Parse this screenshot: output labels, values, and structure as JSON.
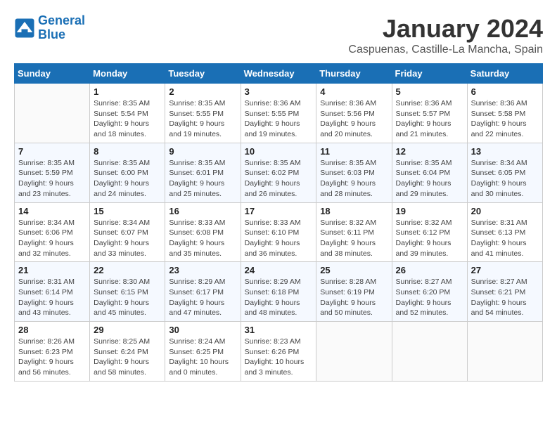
{
  "header": {
    "logo_line1": "General",
    "logo_line2": "Blue",
    "title": "January 2024",
    "subtitle": "Caspuenas, Castille-La Mancha, Spain"
  },
  "days_of_week": [
    "Sunday",
    "Monday",
    "Tuesday",
    "Wednesday",
    "Thursday",
    "Friday",
    "Saturday"
  ],
  "weeks": [
    [
      {
        "day": "",
        "sunrise": "",
        "sunset": "",
        "daylight": ""
      },
      {
        "day": "1",
        "sunrise": "Sunrise: 8:35 AM",
        "sunset": "Sunset: 5:54 PM",
        "daylight": "Daylight: 9 hours and 18 minutes."
      },
      {
        "day": "2",
        "sunrise": "Sunrise: 8:35 AM",
        "sunset": "Sunset: 5:55 PM",
        "daylight": "Daylight: 9 hours and 19 minutes."
      },
      {
        "day": "3",
        "sunrise": "Sunrise: 8:36 AM",
        "sunset": "Sunset: 5:55 PM",
        "daylight": "Daylight: 9 hours and 19 minutes."
      },
      {
        "day": "4",
        "sunrise": "Sunrise: 8:36 AM",
        "sunset": "Sunset: 5:56 PM",
        "daylight": "Daylight: 9 hours and 20 minutes."
      },
      {
        "day": "5",
        "sunrise": "Sunrise: 8:36 AM",
        "sunset": "Sunset: 5:57 PM",
        "daylight": "Daylight: 9 hours and 21 minutes."
      },
      {
        "day": "6",
        "sunrise": "Sunrise: 8:36 AM",
        "sunset": "Sunset: 5:58 PM",
        "daylight": "Daylight: 9 hours and 22 minutes."
      }
    ],
    [
      {
        "day": "7",
        "sunrise": "Sunrise: 8:35 AM",
        "sunset": "Sunset: 5:59 PM",
        "daylight": "Daylight: 9 hours and 23 minutes."
      },
      {
        "day": "8",
        "sunrise": "Sunrise: 8:35 AM",
        "sunset": "Sunset: 6:00 PM",
        "daylight": "Daylight: 9 hours and 24 minutes."
      },
      {
        "day": "9",
        "sunrise": "Sunrise: 8:35 AM",
        "sunset": "Sunset: 6:01 PM",
        "daylight": "Daylight: 9 hours and 25 minutes."
      },
      {
        "day": "10",
        "sunrise": "Sunrise: 8:35 AM",
        "sunset": "Sunset: 6:02 PM",
        "daylight": "Daylight: 9 hours and 26 minutes."
      },
      {
        "day": "11",
        "sunrise": "Sunrise: 8:35 AM",
        "sunset": "Sunset: 6:03 PM",
        "daylight": "Daylight: 9 hours and 28 minutes."
      },
      {
        "day": "12",
        "sunrise": "Sunrise: 8:35 AM",
        "sunset": "Sunset: 6:04 PM",
        "daylight": "Daylight: 9 hours and 29 minutes."
      },
      {
        "day": "13",
        "sunrise": "Sunrise: 8:34 AM",
        "sunset": "Sunset: 6:05 PM",
        "daylight": "Daylight: 9 hours and 30 minutes."
      }
    ],
    [
      {
        "day": "14",
        "sunrise": "Sunrise: 8:34 AM",
        "sunset": "Sunset: 6:06 PM",
        "daylight": "Daylight: 9 hours and 32 minutes."
      },
      {
        "day": "15",
        "sunrise": "Sunrise: 8:34 AM",
        "sunset": "Sunset: 6:07 PM",
        "daylight": "Daylight: 9 hours and 33 minutes."
      },
      {
        "day": "16",
        "sunrise": "Sunrise: 8:33 AM",
        "sunset": "Sunset: 6:08 PM",
        "daylight": "Daylight: 9 hours and 35 minutes."
      },
      {
        "day": "17",
        "sunrise": "Sunrise: 8:33 AM",
        "sunset": "Sunset: 6:10 PM",
        "daylight": "Daylight: 9 hours and 36 minutes."
      },
      {
        "day": "18",
        "sunrise": "Sunrise: 8:32 AM",
        "sunset": "Sunset: 6:11 PM",
        "daylight": "Daylight: 9 hours and 38 minutes."
      },
      {
        "day": "19",
        "sunrise": "Sunrise: 8:32 AM",
        "sunset": "Sunset: 6:12 PM",
        "daylight": "Daylight: 9 hours and 39 minutes."
      },
      {
        "day": "20",
        "sunrise": "Sunrise: 8:31 AM",
        "sunset": "Sunset: 6:13 PM",
        "daylight": "Daylight: 9 hours and 41 minutes."
      }
    ],
    [
      {
        "day": "21",
        "sunrise": "Sunrise: 8:31 AM",
        "sunset": "Sunset: 6:14 PM",
        "daylight": "Daylight: 9 hours and 43 minutes."
      },
      {
        "day": "22",
        "sunrise": "Sunrise: 8:30 AM",
        "sunset": "Sunset: 6:15 PM",
        "daylight": "Daylight: 9 hours and 45 minutes."
      },
      {
        "day": "23",
        "sunrise": "Sunrise: 8:29 AM",
        "sunset": "Sunset: 6:17 PM",
        "daylight": "Daylight: 9 hours and 47 minutes."
      },
      {
        "day": "24",
        "sunrise": "Sunrise: 8:29 AM",
        "sunset": "Sunset: 6:18 PM",
        "daylight": "Daylight: 9 hours and 48 minutes."
      },
      {
        "day": "25",
        "sunrise": "Sunrise: 8:28 AM",
        "sunset": "Sunset: 6:19 PM",
        "daylight": "Daylight: 9 hours and 50 minutes."
      },
      {
        "day": "26",
        "sunrise": "Sunrise: 8:27 AM",
        "sunset": "Sunset: 6:20 PM",
        "daylight": "Daylight: 9 hours and 52 minutes."
      },
      {
        "day": "27",
        "sunrise": "Sunrise: 8:27 AM",
        "sunset": "Sunset: 6:21 PM",
        "daylight": "Daylight: 9 hours and 54 minutes."
      }
    ],
    [
      {
        "day": "28",
        "sunrise": "Sunrise: 8:26 AM",
        "sunset": "Sunset: 6:23 PM",
        "daylight": "Daylight: 9 hours and 56 minutes."
      },
      {
        "day": "29",
        "sunrise": "Sunrise: 8:25 AM",
        "sunset": "Sunset: 6:24 PM",
        "daylight": "Daylight: 9 hours and 58 minutes."
      },
      {
        "day": "30",
        "sunrise": "Sunrise: 8:24 AM",
        "sunset": "Sunset: 6:25 PM",
        "daylight": "Daylight: 10 hours and 0 minutes."
      },
      {
        "day": "31",
        "sunrise": "Sunrise: 8:23 AM",
        "sunset": "Sunset: 6:26 PM",
        "daylight": "Daylight: 10 hours and 3 minutes."
      },
      {
        "day": "",
        "sunrise": "",
        "sunset": "",
        "daylight": ""
      },
      {
        "day": "",
        "sunrise": "",
        "sunset": "",
        "daylight": ""
      },
      {
        "day": "",
        "sunrise": "",
        "sunset": "",
        "daylight": ""
      }
    ]
  ]
}
